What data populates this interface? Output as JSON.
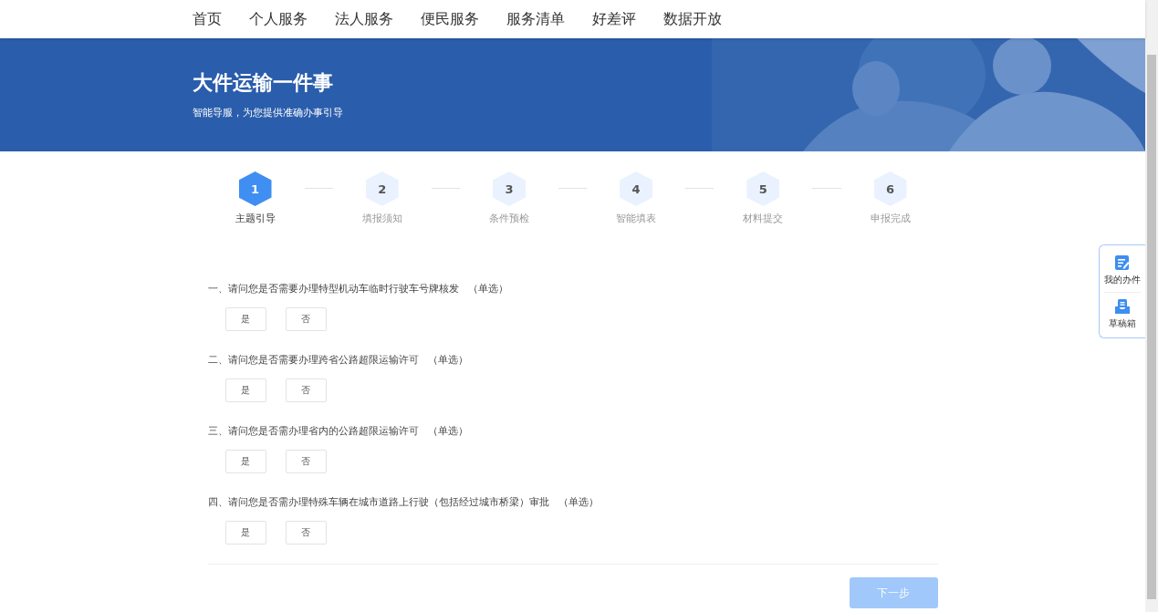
{
  "nav": {
    "items": [
      {
        "label": "首页"
      },
      {
        "label": "个人服务"
      },
      {
        "label": "法人服务"
      },
      {
        "label": "便民服务"
      },
      {
        "label": "服务清单"
      },
      {
        "label": "好差评"
      },
      {
        "label": "数据开放"
      }
    ]
  },
  "banner": {
    "title": "大件运输一件事",
    "subtitle": "智能导服，为您提供准确办事引导"
  },
  "steps": [
    {
      "number": "1",
      "label": "主题引导",
      "selected": true
    },
    {
      "number": "2",
      "label": "填报须知",
      "selected": false
    },
    {
      "number": "3",
      "label": "条件预检",
      "selected": false
    },
    {
      "number": "4",
      "label": "智能填表",
      "selected": false
    },
    {
      "number": "5",
      "label": "材料提交",
      "selected": false
    },
    {
      "number": "6",
      "label": "申报完成",
      "selected": false
    }
  ],
  "questions": [
    {
      "text": "一、请问您是否需要办理特型机动车临时行驶车号牌核发",
      "mode": "（单选）",
      "options": [
        {
          "label": "是",
          "selected": false
        },
        {
          "label": "否",
          "selected": false
        }
      ]
    },
    {
      "text": "二、请问您是否需要办理跨省公路超限运输许可",
      "mode": "（单选）",
      "options": [
        {
          "label": "是",
          "selected": false
        },
        {
          "label": "否",
          "selected": false
        }
      ]
    },
    {
      "text": "三、请问您是否需办理省内的公路超限运输许可",
      "mode": "（单选）",
      "options": [
        {
          "label": "是",
          "selected": false
        },
        {
          "label": "否",
          "selected": false
        }
      ]
    },
    {
      "text": "四、请问您是否需办理特殊车辆在城市道路上行驶（包括经过城市桥梁）审批",
      "mode": "（单选）",
      "options": [
        {
          "label": "是",
          "selected": false
        },
        {
          "label": "否",
          "selected": false
        }
      ]
    }
  ],
  "next_button": {
    "label": "下一步",
    "disabled": true
  },
  "side_panel": {
    "items": [
      {
        "kind": "tasks",
        "label": "我的办件"
      },
      {
        "kind": "drafts",
        "label": "草稿箱"
      }
    ]
  }
}
